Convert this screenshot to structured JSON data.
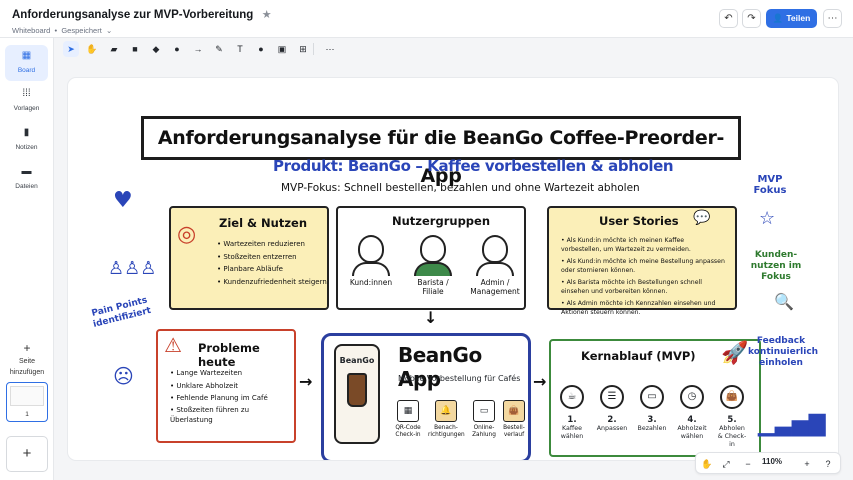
{
  "header": {
    "title": "Anforderungsanalyse zur MVP-Vorbereitung",
    "type_label": "Whiteboard",
    "status": "Gespeichert",
    "share_label": "Teilen"
  },
  "sidebar": {
    "items": [
      {
        "label": "Board",
        "icon": "board-icon"
      },
      {
        "label": "Vorlagen",
        "icon": "templates-icon"
      },
      {
        "label": "Notizen",
        "icon": "notes-icon"
      },
      {
        "label": "Dateien",
        "icon": "files-icon"
      }
    ],
    "add_page_line1": "Seite",
    "add_page_line2": "hinzufügen",
    "page_number": "1"
  },
  "zoom": {
    "value": "110%"
  },
  "board": {
    "banner": "Anforderungsanalyse für die BeanGo Coffee-Preorder-App",
    "product": "Produkt: BeanGo – Kaffee vorbestellen & abholen",
    "mvp_focus": "MVP-Fokus: Schnell bestellen, bezahlen und ohne Wartezeit abholen",
    "goal": {
      "title": "Ziel & Nutzen",
      "items": [
        "Wartezeiten reduzieren",
        "Stoßzeiten entzerren",
        "Planbare Abläufe",
        "Kundenzufriedenheit steigern"
      ]
    },
    "users": {
      "title": "Nutzergruppen",
      "personas": [
        {
          "line1": "Kund:innen",
          "line2": ""
        },
        {
          "line1": "Barista /",
          "line2": "Filiale"
        },
        {
          "line1": "Admin /",
          "line2": "Management"
        }
      ]
    },
    "stories": {
      "title": "User Stories",
      "items": [
        "Als Kund:in möchte ich meinen Kaffee vorbestellen, um Wartezeit zu vermeiden.",
        "Als Kund:in möchte ich meine Bestellung anpassen oder stornieren können.",
        "Als Barista möchte ich Bestellungen schnell einsehen und vorbereiten können.",
        "Als Admin möchte ich Kennzahlen einsehen und Aktionen steuern können."
      ]
    },
    "problems": {
      "title": "Probleme heute",
      "items": [
        "Lange Wartezeiten",
        "Unklare Abholzeit",
        "Fehlende Planung im Café",
        "Stoßzeiten führen zu Überlastung"
      ]
    },
    "app": {
      "phone_label": "BeanGo",
      "title": "BeanGo App",
      "subtitle": "Mobile Vorbestellung für Cafés",
      "features": [
        {
          "line1": "QR-Code",
          "line2": "Check-in"
        },
        {
          "line1": "Benach-",
          "line2": "richtigungen"
        },
        {
          "line1": "Online-",
          "line2": "Zahlung"
        },
        {
          "line1": "Bestell-",
          "line2": "verlauf"
        }
      ]
    },
    "flow": {
      "title": "Kernablauf (MVP)",
      "steps": [
        {
          "n": "1.",
          "line1": "Kaffee",
          "line2": "wählen"
        },
        {
          "n": "2.",
          "line1": "Anpassen",
          "line2": ""
        },
        {
          "n": "3.",
          "line1": "Bezahlen",
          "line2": ""
        },
        {
          "n": "4.",
          "line1": "Abholzeit",
          "line2": "wählen"
        },
        {
          "n": "5.",
          "line1": "Abholen",
          "line2": "& Check-in"
        }
      ]
    },
    "notes": {
      "pain_points": "Pain Points identifiziert",
      "mvp_fokus": "MVP Fokus",
      "kundennutzen": "Kunden-nutzen im Fokus",
      "feedback": "Feedback kontinuierlich einholen"
    }
  }
}
